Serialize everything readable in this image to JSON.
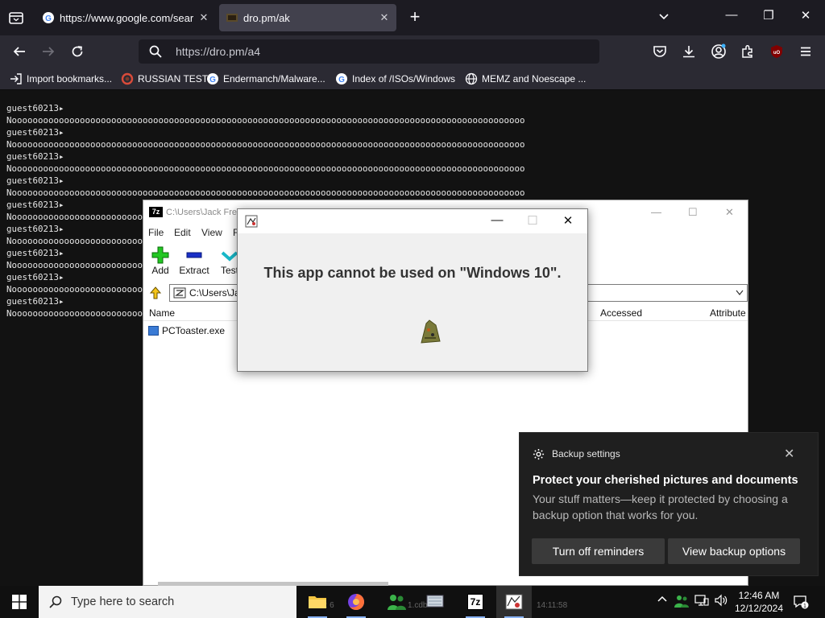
{
  "browser": {
    "tabs": [
      {
        "title": "https://www.google.com/searc",
        "close": "✕"
      },
      {
        "title": "dro.pm/ak",
        "close": "✕"
      }
    ],
    "url": "https://dro.pm/a4",
    "window_controls": {
      "minimize": "—",
      "maximize": "❐",
      "close": "✕"
    },
    "bookmarks": [
      {
        "label": "Import bookmarks...",
        "icon": "import-icon"
      },
      {
        "label": "RUSSIAN TEST",
        "icon": "red-circle-icon"
      },
      {
        "label": "Endermanch/Malware...",
        "icon": "google-g-icon"
      },
      {
        "label": "Index of /ISOs/Windows",
        "icon": "google-g-icon"
      },
      {
        "label": "MEMZ and Noescape ...",
        "icon": "globe-icon"
      }
    ]
  },
  "terminal": {
    "lines": [
      "guest60213▸",
      "Noooooooooooooooooooooooooooooooooooooooooooooooooooooooooooooooooooooooooooooooooooooooooooooooooo",
      "guest60213▸",
      "Noooooooooooooooooooooooooooooooooooooooooooooooooooooooooooooooooooooooooooooooooooooooooooooooooo",
      "guest60213▸",
      "Noooooooooooooooooooooooooooooooooooooooooooooooooooooooooooooooooooooooooooooooooooooooooooooooooo",
      "guest60213▸",
      "Noooooooooooooooooooooooooooooooooooooooooooooooooooooooooooooooooooooooooooooooooooooooooooooooooo",
      "guest60213▸",
      "Noooooooooooooooooooooooooooooooooooooooooooooooooooooooooooooooooooooooooooooooooooooooooooooooooo",
      "guest60213▸",
      "Noooooooooooooooooooooooooooooooooooooooooooooooooooooooooooooooooooooooooooooooooooooooooooooooooo",
      "guest60213▸",
      "Noooooooooooooooooooooooooooooooooooooooooooooooooooooooooooooooooooooooooooooooooooooooooooooooooo",
      "guest60213▸",
      "Noooooooooooooooooooooooooooooooooooooooooooooooooooooooooooooooooooooooooooooooooooooooooooooooooo",
      "guest60213▸",
      "Noooooooooooooooooooooooooooooooooooooooooooooooooooooooooooooooooooooooooooooooooooooooooooooooooo"
    ]
  },
  "sevenzip": {
    "title": "C:\\Users\\Jack Fre",
    "logo": "7z",
    "menu": [
      "File",
      "Edit",
      "View",
      "F"
    ],
    "tools": [
      "Add",
      "Extract",
      "Test"
    ],
    "address": "C:\\Users\\Jac",
    "columns": {
      "name": "Name",
      "accessed": "Accessed",
      "attributes": "Attribute"
    },
    "files": [
      {
        "name": "PCToaster.exe"
      }
    ]
  },
  "dialog": {
    "message": "This app cannot be used on \"Windows 10\"."
  },
  "toast": {
    "header": "Backup settings",
    "title": "Protect your cherished pictures and documents",
    "body": "Your stuff matters—keep it protected by choosing a backup option that works for you.",
    "button_primary": "Turn off reminders",
    "button_secondary": "View backup options",
    "close": "✕"
  },
  "taskbar": {
    "search_placeholder": "Type here to search",
    "time": "12:46 AM",
    "date": "12/12/2024",
    "notification_count": "1",
    "sevenzip_label": "7z"
  },
  "colors": {
    "accent": "#8ab4f8",
    "tab_active": "#42414d",
    "toolbar": "#2b2a33",
    "titlebar": "#1c1b22"
  }
}
